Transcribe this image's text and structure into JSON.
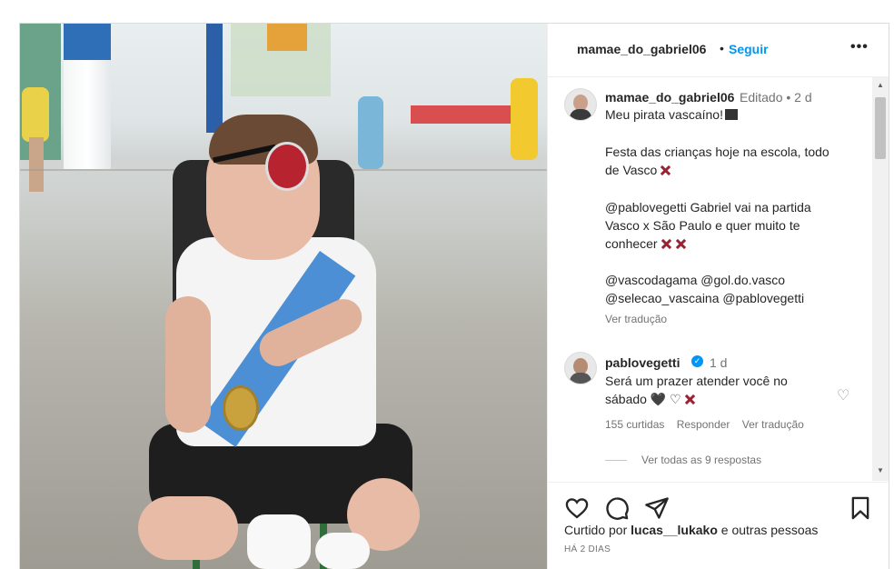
{
  "post": {
    "username": "mamae_do_gabriel06",
    "dot": "•",
    "follow_label": "Seguir",
    "more_icon": "•••"
  },
  "caption": {
    "username": "mamae_do_gabriel06",
    "meta": "Editado • 2 d",
    "lines": [
      "Meu pirata vascaíno!",
      "Festa das crianças hoje na escola, todo",
      "de Vasco",
      "@pablovegetti Gabriel vai na partida",
      "Vasco x São Paulo e quer muito te",
      "conhecer",
      "@vascodagama @gol.do.vasco",
      "@selecao_vascaina @pablovegetti"
    ],
    "translate": "Ver tradução"
  },
  "reply": {
    "username": "pablovegetti",
    "verified_mark": "✓",
    "time": "1 d",
    "line1": "Será um prazer atender você no",
    "line2": "sábado",
    "hearts": "🖤 ♡",
    "likes": "155 curtidas",
    "reply_label": "Responder",
    "translate": "Ver tradução",
    "view_all": "Ver todas as 9 respostas"
  },
  "footer": {
    "liked_by_prefix": "Curtido por ",
    "liked_by_user": "lucas__lukako",
    "liked_by_suffix": " e outras pessoas",
    "timestamp": "HÁ 2 DIAS"
  },
  "icons": {
    "like": "heart-icon",
    "comment": "comment-icon",
    "share": "send-icon",
    "save": "bookmark-icon"
  },
  "colors": {
    "accent": "#0095f6",
    "text": "#262626",
    "secondary": "#737373"
  }
}
